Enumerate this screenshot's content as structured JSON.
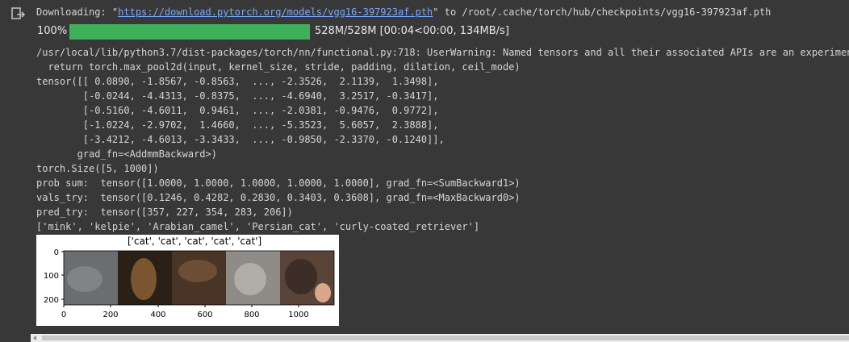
{
  "output_icon": "output-arrow-icon",
  "download": {
    "prefix": "Downloading: \"",
    "url": "https://download.pytorch.org/models/vgg16-397923af.pth",
    "suffix": "\" to /root/.cache/torch/hub/checkpoints/vgg16-397923af.pth"
  },
  "progress": {
    "percent_label": "100%",
    "fraction": 1.0,
    "info": "528M/528M [00:04<00:00, 134MB/s]"
  },
  "lines": [
    "/usr/local/lib/python3.7/dist-packages/torch/nn/functional.py:718: UserWarning: Named tensors and all their associated APIs are an experimental",
    "  return torch.max_pool2d(input, kernel_size, stride, padding, dilation, ceil_mode)",
    "tensor([[ 0.0890, -1.8567, -0.8563,  ..., -2.3526,  2.1139,  1.3498],",
    "        [-0.0244, -4.4313, -0.8375,  ..., -4.6940,  3.2517, -0.3417],",
    "        [-0.5160, -4.6011,  0.9461,  ..., -2.0381, -0.9476,  0.9772],",
    "        [-1.0224, -2.9702,  1.4660,  ..., -5.3523,  5.6057,  2.3888],",
    "        [-3.4212, -4.6013, -3.3433,  ..., -0.9850, -2.3370, -0.1240]],",
    "       grad_fn=<AddmmBackward>)",
    "torch.Size([5, 1000])",
    "prob sum:  tensor([1.0000, 1.0000, 1.0000, 1.0000, 1.0000], grad_fn=<SumBackward1>)",
    "vals_try:  tensor([0.1246, 0.4282, 0.2830, 0.3403, 0.3608], grad_fn=<MaxBackward0>)",
    "pred_try:  tensor([357, 227, 354, 283, 206])",
    "['mink', 'kelpie', 'Arabian_camel', 'Persian_cat', 'curly-coated_retriever']"
  ],
  "figure": {
    "title": "['cat', 'cat', 'cat', 'cat', 'cat']",
    "y_ticks": [
      "0",
      "100",
      "200"
    ],
    "x_ticks": [
      "0",
      "200",
      "400",
      "600",
      "800",
      "1000"
    ],
    "tile_colors": [
      "#6b6e70",
      "#2a2016",
      "#4a3426",
      "#8f8b86",
      "#5a4338"
    ]
  }
}
